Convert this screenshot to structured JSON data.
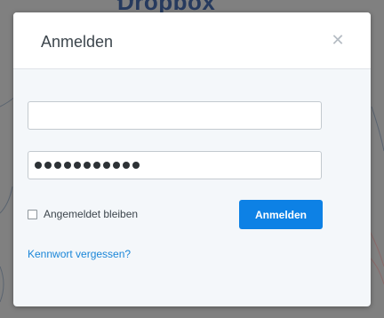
{
  "background": {
    "logo_text": "Dropbox",
    "logo_icon": "dropbox-icon"
  },
  "dialog": {
    "title": "Anmelden",
    "close_icon": "close-icon",
    "email": {
      "value": "",
      "placeholder": ""
    },
    "password": {
      "masked_length": 11
    },
    "remember_label": "Angemeldet bleiben",
    "remember_checked": false,
    "submit_label": "Anmelden",
    "forgot_label": "Kennwort vergessen?"
  },
  "colors": {
    "primary_button": "#0d81e5",
    "link": "#1a86d8",
    "title_text": "#3d464d"
  }
}
